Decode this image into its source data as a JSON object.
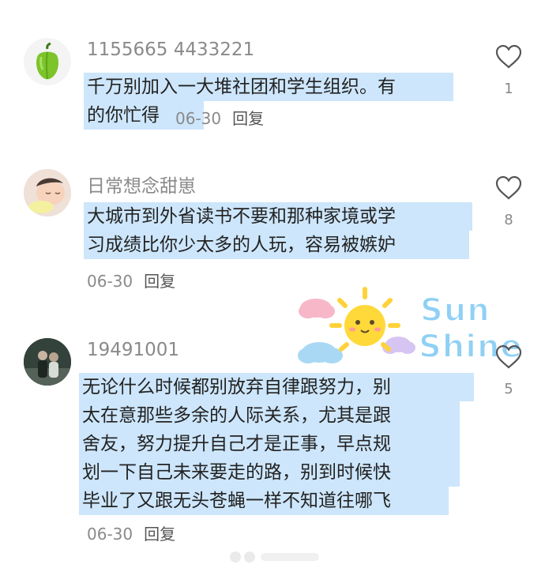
{
  "comments": [
    {
      "username": "1155665 4433221",
      "lines": [
        "千万别加入一大堆社团和学生组织。有",
        "的你忙得"
      ],
      "date": "06-30",
      "reply_label": "回复",
      "like_count": "1",
      "avatar_icon": "green-pepper-icon"
    },
    {
      "username": "日常想念甜崽",
      "lines": [
        "大城市到外省读书不要和那种家境或学",
        "习成绩比你少太多的人玩，容易被嫉妒"
      ],
      "date": "06-30",
      "reply_label": "回复",
      "like_count": "8",
      "avatar_icon": "sleeping-baby-photo"
    },
    {
      "username": "19491001",
      "lines": [
        "无论什么时候都别放弃自律跟努力，别",
        "太在意那些多余的人际关系，尤其是跟",
        "舍友，努力提升自己才是正事，早点规",
        "划一下自己未来要走的路，别到时候快",
        "毕业了又跟无头苍蝇一样不知道往哪飞"
      ],
      "date": "06-30",
      "reply_label": "回复",
      "like_count": "5",
      "avatar_icon": "couple-photo"
    }
  ],
  "sticker": {
    "word1": "Sun",
    "word2": "Shine",
    "icon": "smiling-sun-sticker"
  },
  "colors": {
    "highlight": "#c4e2fa",
    "meta_text": "#8a8a8a",
    "sticker_text": "#8fd0f5"
  }
}
